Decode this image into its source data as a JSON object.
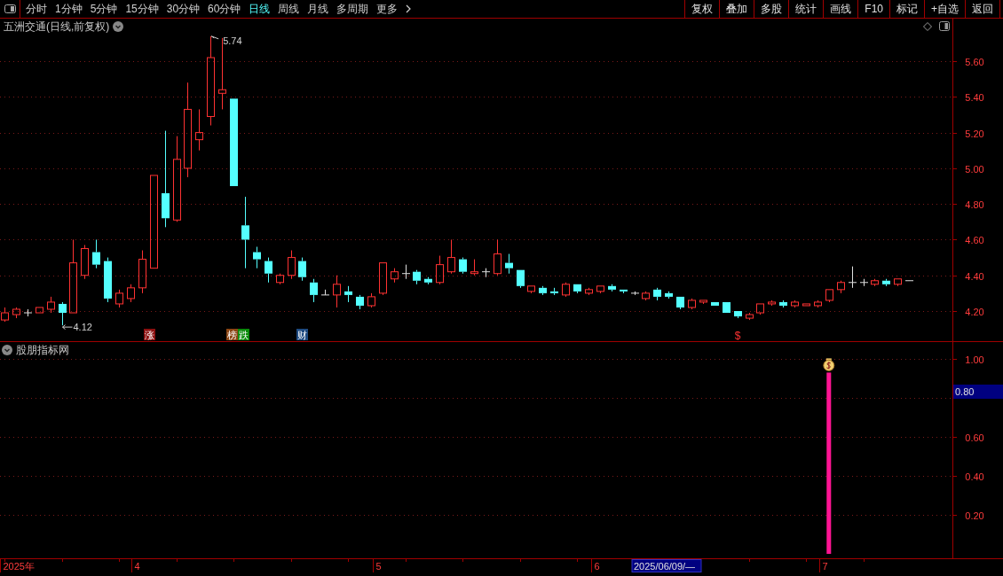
{
  "toolbar": {
    "periods": [
      {
        "label": "分时",
        "selected": false
      },
      {
        "label": "1分钟",
        "selected": false
      },
      {
        "label": "5分钟",
        "selected": false
      },
      {
        "label": "15分钟",
        "selected": false
      },
      {
        "label": "30分钟",
        "selected": false
      },
      {
        "label": "60分钟",
        "selected": false
      },
      {
        "label": "日线",
        "selected": true
      },
      {
        "label": "周线",
        "selected": false
      },
      {
        "label": "月线",
        "selected": false
      },
      {
        "label": "多周期",
        "selected": false
      },
      {
        "label": "更多",
        "selected": false
      }
    ],
    "actions": [
      "复权",
      "叠加",
      "多股",
      "统计",
      "画线",
      "F10",
      "标记",
      "+自选",
      "返回"
    ]
  },
  "price_pane": {
    "title": "五洲交通(日线,前复权)",
    "axis_labels": [
      "5.60",
      "5.40",
      "5.20",
      "5.00",
      "4.80",
      "4.60",
      "4.40",
      "4.20"
    ],
    "high_label": "5.74",
    "low_label": "4.12",
    "event_tags": [
      {
        "label": "涨",
        "color": "#8b1010"
      },
      {
        "label": "榜",
        "color": "#8b4513"
      },
      {
        "label": "跌",
        "color": "#0a8a0a"
      },
      {
        "label": "财",
        "color": "#1e4a80"
      }
    ],
    "signal_mark": {
      "label": "$",
      "color": "#ff3232"
    }
  },
  "indicator_pane": {
    "title": "股朋指标网",
    "axis_labels": [
      "1.00",
      "0.60",
      "0.40",
      "0.20"
    ],
    "cursor_value": "0.80"
  },
  "date_axis": {
    "labels": [
      "2025年",
      "4",
      "5",
      "6",
      "7"
    ],
    "cursor_date": "2025/06/09/—"
  }
}
